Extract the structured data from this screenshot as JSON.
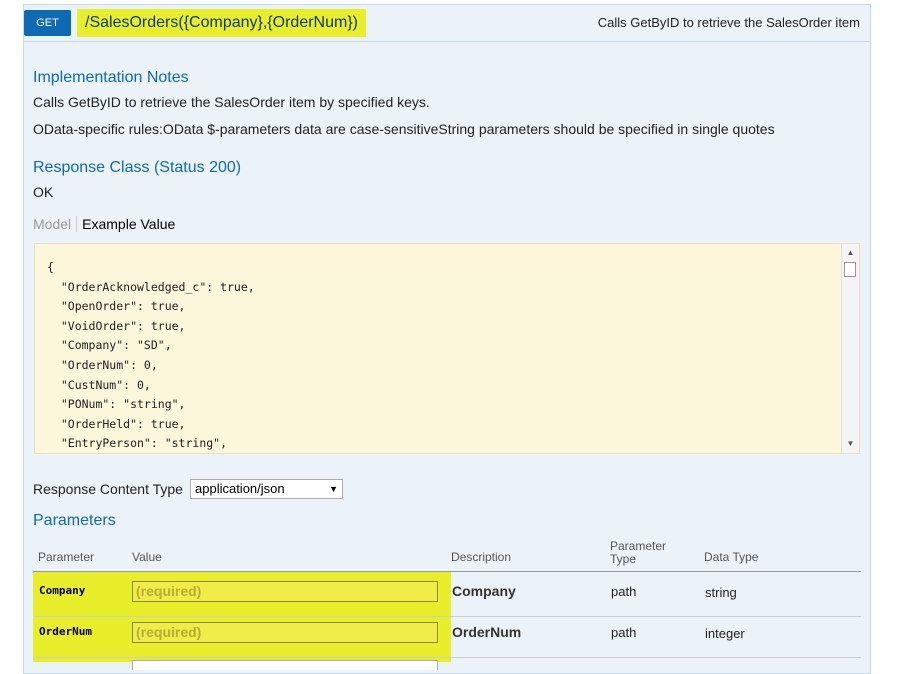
{
  "operation": {
    "method": "GET",
    "path": "/SalesOrders({Company},{OrderNum})",
    "summary": "Calls GetByID to retrieve the SalesOrder item"
  },
  "implementation_notes": {
    "title": "Implementation Notes",
    "description": "Calls GetByID to retrieve the SalesOrder item by specified keys.",
    "odata_rules": "OData-specific rules:OData $-parameters data are case-sensitiveString parameters should be specified in single quotes"
  },
  "response_class": {
    "title": "Response Class (Status 200)",
    "status_text": "OK",
    "tabs": {
      "model": "Model",
      "example": "Example Value"
    },
    "example_lines": [
      "{",
      "  \"OrderAcknowledged_c\": true,",
      "  \"OpenOrder\": true,",
      "  \"VoidOrder\": true,",
      "  \"Company\": \"SD\",",
      "  \"OrderNum\": 0,",
      "  \"CustNum\": 0,",
      "  \"PONum\": \"string\",",
      "  \"OrderHeld\": true,",
      "  \"EntryPerson\": \"string\","
    ]
  },
  "response_content_type": {
    "label": "Response Content Type",
    "selected": "application/json"
  },
  "parameters": {
    "title": "Parameters",
    "headers": {
      "parameter": "Parameter",
      "value": "Value",
      "description": "Description",
      "parameter_type_1": "Parameter",
      "parameter_type_2": "Type",
      "data_type": "Data Type"
    },
    "rows": [
      {
        "name": "Company",
        "placeholder": "(required)",
        "description": "Company",
        "param_type": "path",
        "data_type": "string"
      },
      {
        "name": "OrderNum",
        "placeholder": "(required)",
        "description": "OrderNum",
        "param_type": "path",
        "data_type": "integer"
      }
    ]
  },
  "colors": {
    "accent": "#0f6ab4",
    "highlight": "#e8ef2a",
    "panel_bg": "#ebf3f9",
    "example_bg": "#fcf6db"
  }
}
